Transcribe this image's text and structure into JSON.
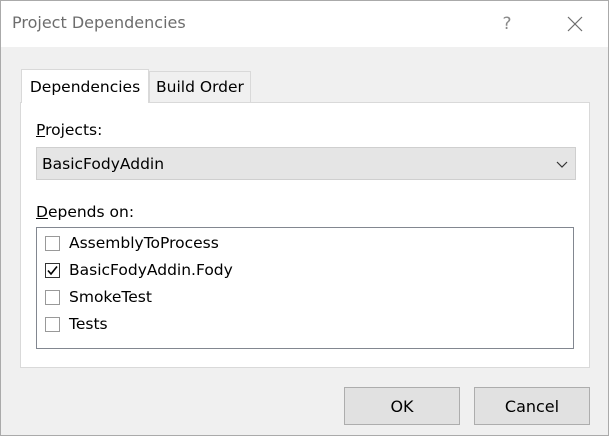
{
  "window": {
    "title": "Project Dependencies",
    "help_label": "?"
  },
  "tabs": [
    {
      "label": "Dependencies",
      "active": true
    },
    {
      "label": "Build Order",
      "active": false
    }
  ],
  "projects": {
    "label_accel": "P",
    "label_rest": "rojects:",
    "selected": "BasicFodyAddin"
  },
  "depends_on": {
    "label_accel": "D",
    "label_rest": "epends on:",
    "items": [
      {
        "label": "AssemblyToProcess",
        "checked": false
      },
      {
        "label": "BasicFodyAddin.Fody",
        "checked": true
      },
      {
        "label": "SmokeTest",
        "checked": false
      },
      {
        "label": "Tests",
        "checked": false
      }
    ]
  },
  "buttons": {
    "ok": "OK",
    "cancel": "Cancel"
  },
  "icons": {
    "close": "close-icon",
    "dropdown": "chevron-down-icon",
    "check": "checkmark-icon"
  }
}
